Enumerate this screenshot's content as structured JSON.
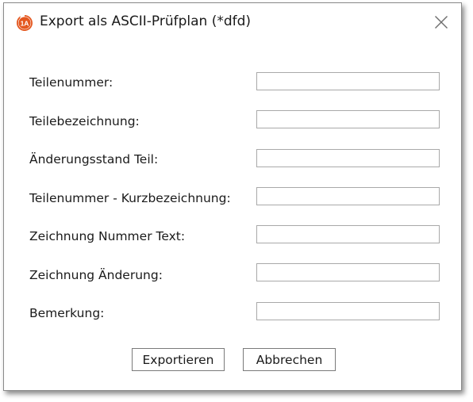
{
  "window": {
    "title": "Export als ASCII-Prüfplan (*dfd)",
    "app_icon": "app-logo-icon",
    "icon_text": "1A",
    "accent_color": "#e4571f"
  },
  "fields": [
    {
      "label": "Teilenummer:",
      "value": ""
    },
    {
      "label": "Teilebezeichnung:",
      "value": ""
    },
    {
      "label": "Änderungsstand Teil:",
      "value": ""
    },
    {
      "label": "Teilenummer - Kurzbezeichnung:",
      "value": ""
    },
    {
      "label": "Zeichnung Nummer Text:",
      "value": ""
    },
    {
      "label": "Zeichnung Änderung:",
      "value": ""
    },
    {
      "label": "Bemerkung:",
      "value": ""
    }
  ],
  "buttons": {
    "export_label": "Exportieren",
    "cancel_label": "Abbrechen"
  }
}
